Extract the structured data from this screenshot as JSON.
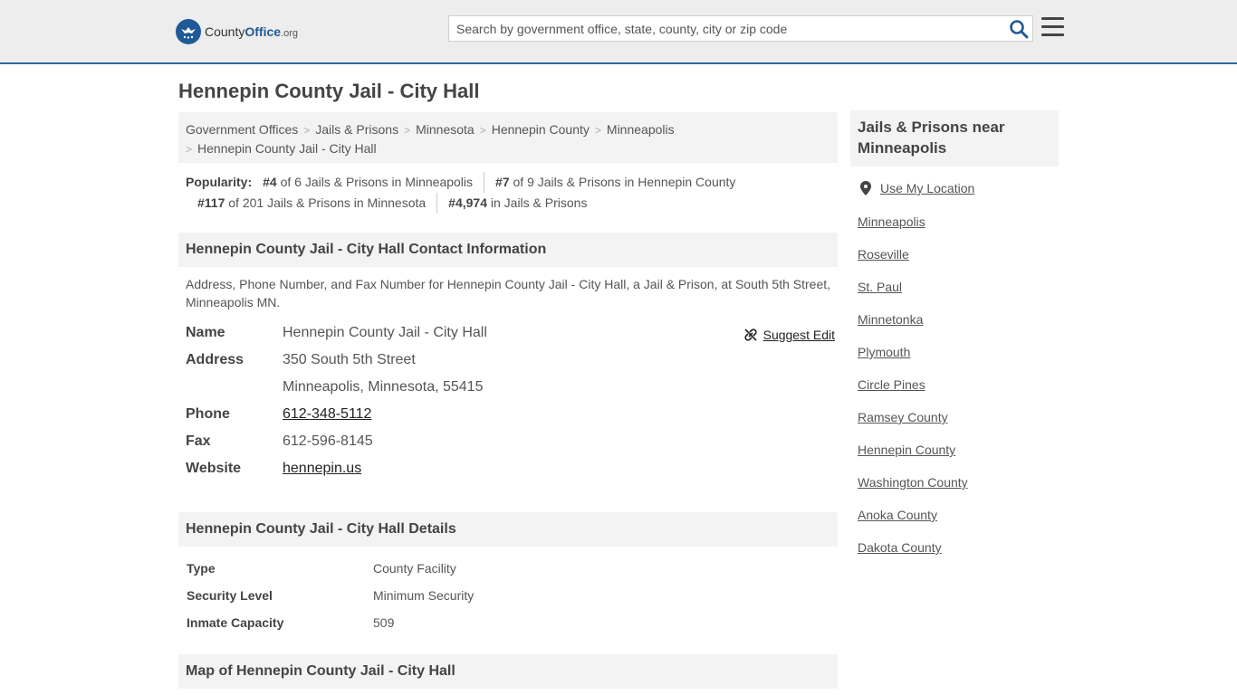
{
  "header": {
    "logo_brand": "County",
    "logo_brand2": "Office",
    "logo_tld": ".org",
    "search_placeholder": "Search by government office, state, county, city or zip code"
  },
  "page_title": "Hennepin County Jail - City Hall",
  "breadcrumb": [
    "Government Offices",
    "Jails & Prisons",
    "Minnesota",
    "Hennepin County",
    "Minneapolis",
    "Hennepin County Jail - City Hall"
  ],
  "popularity": {
    "label": "Popularity:",
    "items": [
      {
        "rank": "#4",
        "text": "of 6 Jails & Prisons in Minneapolis"
      },
      {
        "rank": "#7",
        "text": "of 9 Jails & Prisons in Hennepin County"
      },
      {
        "rank": "#117",
        "text": "of 201 Jails & Prisons in Minnesota"
      },
      {
        "rank": "#4,974",
        "text": "in Jails & Prisons"
      }
    ]
  },
  "contact": {
    "heading": "Hennepin County Jail - City Hall Contact Information",
    "description": "Address, Phone Number, and Fax Number for Hennepin County Jail - City Hall, a Jail & Prison, at South 5th Street, Minneapolis MN.",
    "suggest_edit": "Suggest Edit",
    "labels": {
      "name": "Name",
      "address": "Address",
      "phone": "Phone",
      "fax": "Fax",
      "website": "Website"
    },
    "name": "Hennepin County Jail - City Hall",
    "address_line1": "350 South 5th Street",
    "address_line2": "Minneapolis, Minnesota, 55415",
    "phone": "612-348-5112",
    "fax": "612-596-8145",
    "website": "hennepin.us"
  },
  "details": {
    "heading": "Hennepin County Jail - City Hall Details",
    "rows": [
      {
        "label": "Type",
        "value": "County Facility"
      },
      {
        "label": "Security Level",
        "value": "Minimum Security"
      },
      {
        "label": "Inmate Capacity",
        "value": "509"
      }
    ]
  },
  "map_heading": "Map of Hennepin County Jail - City Hall",
  "sidebar": {
    "heading": "Jails & Prisons near Minneapolis",
    "use_location": "Use My Location",
    "links": [
      "Minneapolis",
      "Roseville",
      "St. Paul",
      "Minnetonka",
      "Plymouth",
      "Circle Pines",
      "Ramsey County",
      "Hennepin County",
      "Washington County",
      "Anoka County",
      "Dakota County"
    ]
  },
  "colors": {
    "accent": "#1f5a96",
    "header_bg": "#ededed",
    "panel_bg": "#f3f3f3"
  }
}
